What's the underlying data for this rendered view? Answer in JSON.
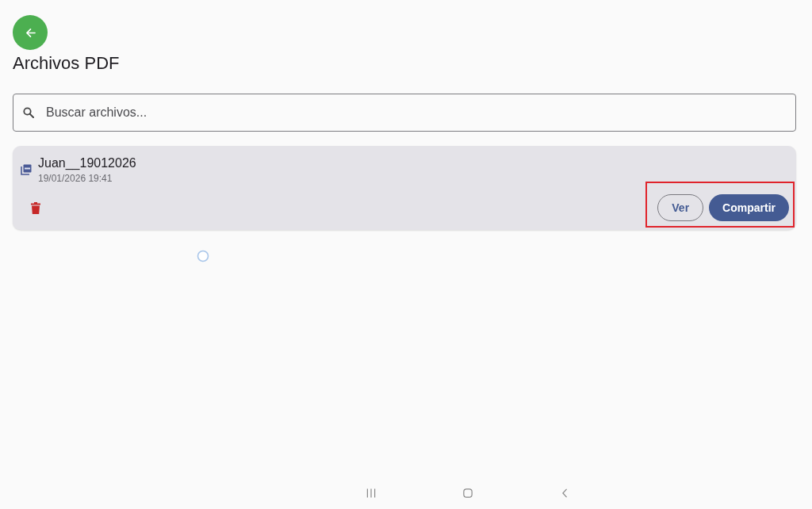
{
  "header": {
    "title": "Archivos PDF"
  },
  "search": {
    "placeholder": "Buscar archivos..."
  },
  "files": [
    {
      "name": "Juan__19012026",
      "date": "19/01/2026 19:41",
      "actions_highlighted": true,
      "actions": [
        {
          "label": "Ver",
          "kind": "outlined"
        },
        {
          "label": "Compartir",
          "kind": "filled"
        }
      ]
    }
  ],
  "touch_indicator": true
}
